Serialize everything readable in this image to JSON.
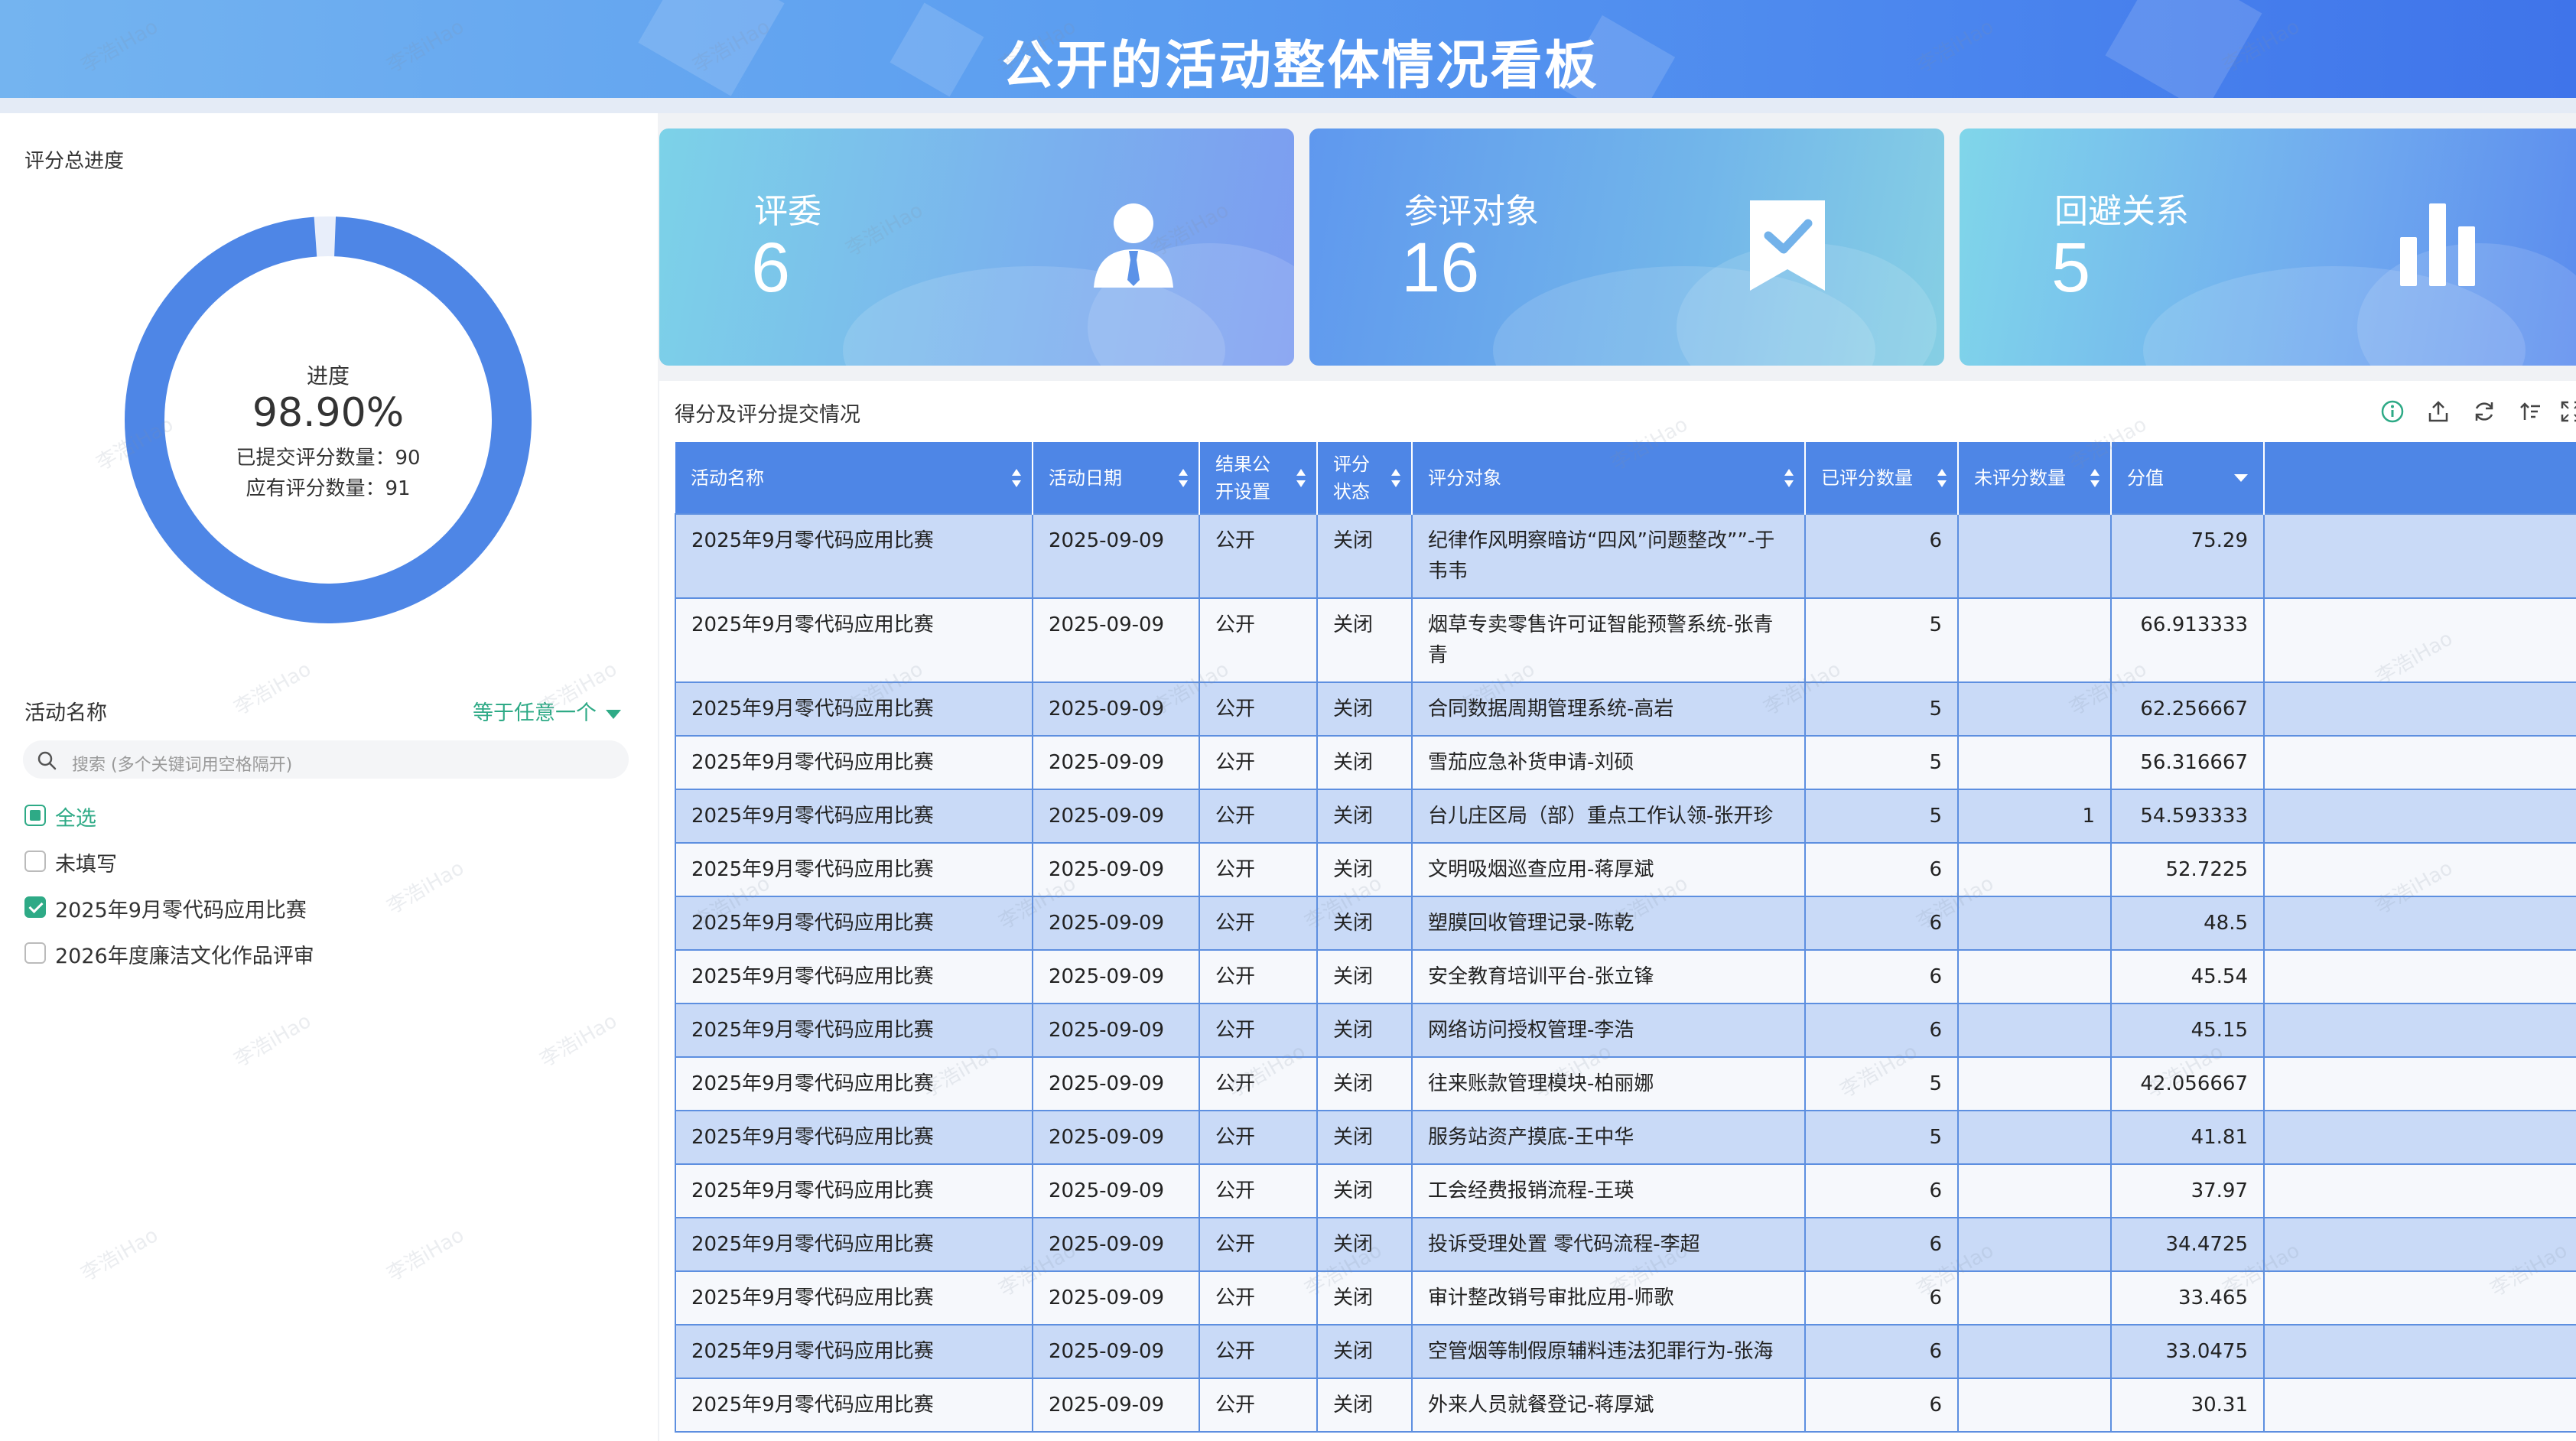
{
  "header": {
    "title": "公开的活动整体情况看板"
  },
  "progress": {
    "title": "评分总进度",
    "label": "进度",
    "percent": "98.90%",
    "fraction": 0.989,
    "submitted_label": "已提交评分数量：",
    "submitted": "90",
    "expected_label": "应有评分数量：",
    "expected": "91",
    "color": "#4e86e6"
  },
  "filter": {
    "title": "活动名称",
    "mode": "等于任意一个",
    "search_placeholder": "搜索 (多个关键词用空格隔开)",
    "options": [
      {
        "label": "全选",
        "state": "partial"
      },
      {
        "label": "未填写",
        "state": "unchecked"
      },
      {
        "label": "2025年9月零代码应用比赛",
        "state": "checked"
      },
      {
        "label": "2026年度廉洁文化作品评审",
        "state": "unchecked"
      }
    ]
  },
  "cards": [
    {
      "title": "评委",
      "value": "6",
      "icon": "person-icon"
    },
    {
      "title": "参评对象",
      "value": "16",
      "icon": "bookmark-check-icon"
    },
    {
      "title": "回避关系",
      "value": "5",
      "icon": "bar-chart-icon"
    }
  ],
  "table": {
    "title": "得分及评分提交情况",
    "tools": [
      "info-icon",
      "export-icon",
      "refresh-icon",
      "sort-icon",
      "fullscreen-icon"
    ],
    "columns": [
      "活动名称",
      "活动日期",
      "结果公开设置",
      "评分状态",
      "评分对象",
      "已评分数量",
      "未评分数量",
      "分值"
    ],
    "rows": [
      [
        "2025年9月零代码应用比赛",
        "2025-09-09",
        "公开",
        "关闭",
        "纪律作风明察暗访“四风”问题整改””-于韦韦",
        "6",
        "",
        "75.29"
      ],
      [
        "2025年9月零代码应用比赛",
        "2025-09-09",
        "公开",
        "关闭",
        "烟草专卖零售许可证智能预警系统-张青青",
        "5",
        "",
        "66.913333"
      ],
      [
        "2025年9月零代码应用比赛",
        "2025-09-09",
        "公开",
        "关闭",
        "合同数据周期管理系统-高岩",
        "5",
        "",
        "62.256667"
      ],
      [
        "2025年9月零代码应用比赛",
        "2025-09-09",
        "公开",
        "关闭",
        "雪茄应急补货申请-刘硕",
        "5",
        "",
        "56.316667"
      ],
      [
        "2025年9月零代码应用比赛",
        "2025-09-09",
        "公开",
        "关闭",
        "台儿庄区局（部）重点工作认领-张开珍",
        "5",
        "1",
        "54.593333"
      ],
      [
        "2025年9月零代码应用比赛",
        "2025-09-09",
        "公开",
        "关闭",
        "文明吸烟巡查应用-蒋厚斌",
        "6",
        "",
        "52.7225"
      ],
      [
        "2025年9月零代码应用比赛",
        "2025-09-09",
        "公开",
        "关闭",
        "塑膜回收管理记录-陈乾",
        "6",
        "",
        "48.5"
      ],
      [
        "2025年9月零代码应用比赛",
        "2025-09-09",
        "公开",
        "关闭",
        "安全教育培训平台-张立锋",
        "6",
        "",
        "45.54"
      ],
      [
        "2025年9月零代码应用比赛",
        "2025-09-09",
        "公开",
        "关闭",
        "网络访问授权管理-李浩",
        "6",
        "",
        "45.15"
      ],
      [
        "2025年9月零代码应用比赛",
        "2025-09-09",
        "公开",
        "关闭",
        "往来账款管理模块-柏丽娜",
        "5",
        "",
        "42.056667"
      ],
      [
        "2025年9月零代码应用比赛",
        "2025-09-09",
        "公开",
        "关闭",
        "服务站资产摸底-王中华",
        "5",
        "",
        "41.81"
      ],
      [
        "2025年9月零代码应用比赛",
        "2025-09-09",
        "公开",
        "关闭",
        "工会经费报销流程-王瑛",
        "6",
        "",
        "37.97"
      ],
      [
        "2025年9月零代码应用比赛",
        "2025-09-09",
        "公开",
        "关闭",
        "投诉受理处置 零代码流程-李超",
        "6",
        "",
        "34.4725"
      ],
      [
        "2025年9月零代码应用比赛",
        "2025-09-09",
        "公开",
        "关闭",
        "审计整改销号审批应用-师歌",
        "6",
        "",
        "33.465"
      ],
      [
        "2025年9月零代码应用比赛",
        "2025-09-09",
        "公开",
        "关闭",
        "空管烟等制假原辅料违法犯罪行为-张海",
        "6",
        "",
        "33.0475"
      ],
      [
        "2025年9月零代码应用比赛",
        "2025-09-09",
        "公开",
        "关闭",
        "外来人员就餐登记-蒋厚斌",
        "6",
        "",
        "30.31"
      ]
    ]
  },
  "watermark": "李浩iHao"
}
